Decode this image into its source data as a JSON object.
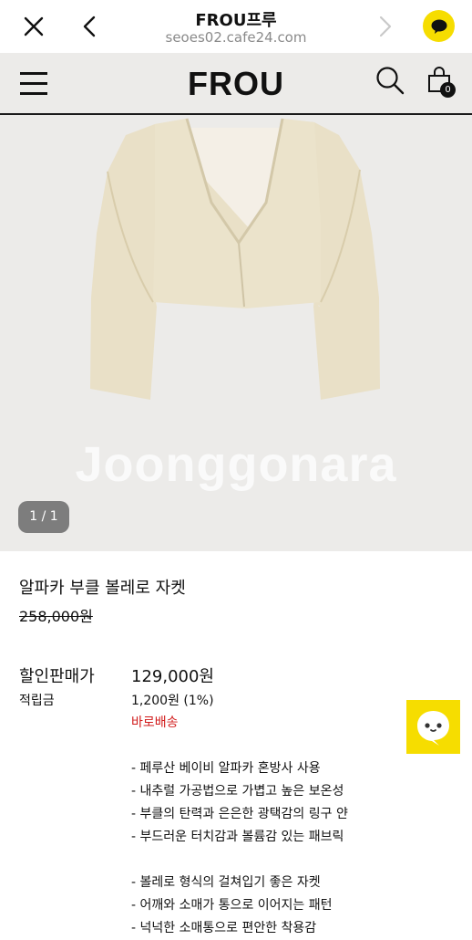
{
  "browser": {
    "title": "FROU프루",
    "url": "seoes02.cafe24.com"
  },
  "header": {
    "logo": "FROU",
    "cart_count": "0"
  },
  "gallery": {
    "watermark": "Joonggonara",
    "pager": "1 / 1"
  },
  "product": {
    "name": "알파카 부클 볼레로 자켓",
    "original_price": "258,000원",
    "sale_label": "할인판매가",
    "sale_price": "129,000원",
    "points_label": "적립금",
    "points_value": "1,200원 (1%)",
    "shipping": "바로배송",
    "description": [
      "- 페루산 베이비 알파카 혼방사 사용",
      "- 내추럴 가공법으로 가볍고 높은 보온성",
      "- 부클의 탄력과 은은한 광택감의 링구 얀",
      "- 부드러운 터치감과 볼륨감 있는 패브릭",
      "",
      "- 볼레로 형식의 걸쳐입기 좋은 자켓",
      "- 어깨와 소매가 통으로 이어지는 패턴",
      "- 넉넉한 소매통으로 편안한 착용감"
    ]
  },
  "colors": {
    "kakao_yellow": "#f6dd00",
    "shipping_red": "#d11b1b",
    "image_bg": "#ecebe9"
  },
  "icons": [
    "close-icon",
    "back-icon",
    "forward-icon",
    "kakaotalk-icon",
    "menu-icon",
    "search-icon",
    "cart-icon",
    "chat-icon"
  ]
}
